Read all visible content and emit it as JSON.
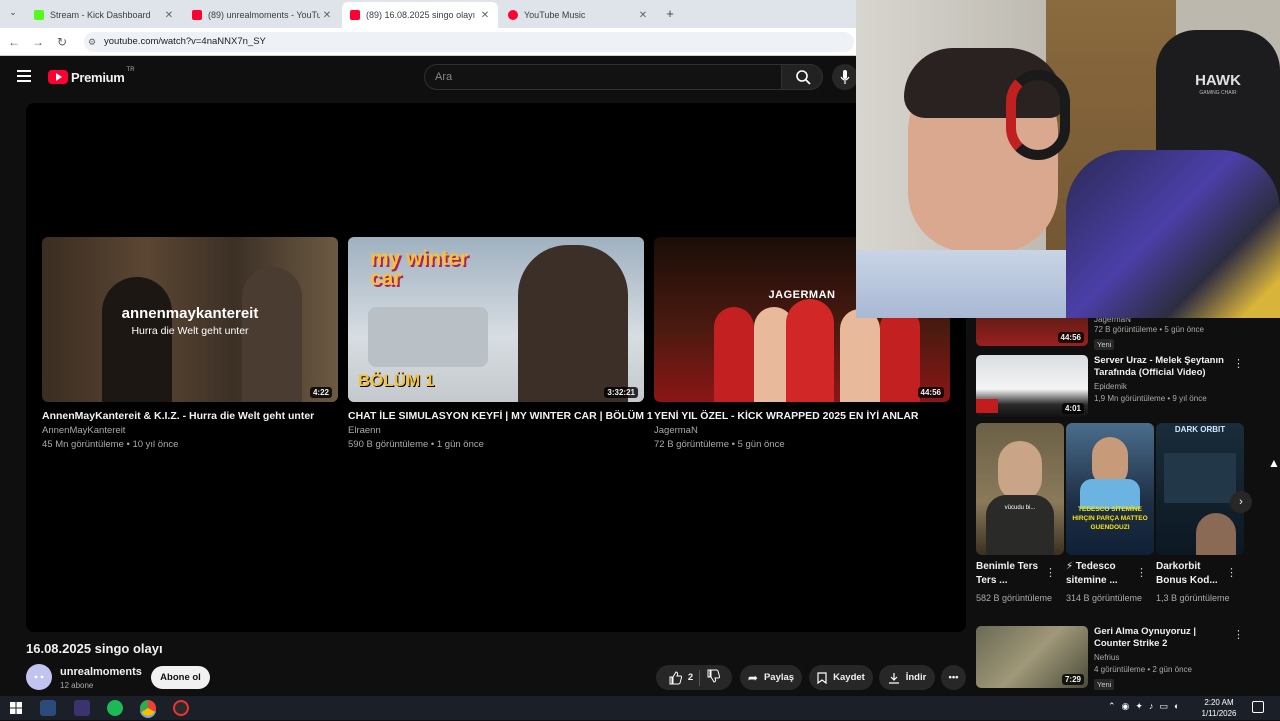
{
  "browser": {
    "tabs": [
      {
        "label": "Stream - Kick Dashboard",
        "fav_color": "#53fc18",
        "active": false
      },
      {
        "label": "(89) unrealmoments - YouTube",
        "fav_color": "#ff0033",
        "active": false
      },
      {
        "label": "(89) 16.08.2025 singo olayı - Yo",
        "fav_color": "#ff0033",
        "active": true
      },
      {
        "label": "YouTube Music",
        "fav_color": "#ff0033",
        "active": false
      }
    ],
    "url": "youtube.com/watch?v=4naNNX7n_SY"
  },
  "masthead": {
    "logo_text": "Premium",
    "country_code": "TR",
    "search_placeholder": "Ara"
  },
  "endscreen": [
    {
      "title": "AnnenMayKantereit & K.I.Z. - Hurra die Welt geht unter",
      "channel": "AnnenMayKantereit",
      "meta": "45 Mn görüntüleme • 10 yıl önce",
      "duration": "4:22",
      "overlay_title": "annenmaykantereit",
      "overlay_sub": "Hurra die Welt geht unter"
    },
    {
      "title": "CHAT İLE SIMULASYON KEYFİ | MY WINTER CAR | BÖLÜM 1",
      "channel": "Elraenn",
      "meta": "590 B görüntüleme • 1 gün önce",
      "duration": "3:32:21",
      "overlay_title": "my winter car",
      "overlay_sub": "BÖLÜM 1"
    },
    {
      "title": "YENİ YIL ÖZEL - KİCK WRAPPED 2025 EN İYİ ANLAR",
      "channel": "JagermaN",
      "meta": "72 B görüntüleme • 5 gün önce",
      "duration": "44:56",
      "overlay_title": "JAGERMAN",
      "overlay_sub": ""
    }
  ],
  "video": {
    "title": "16.08.2025 singo olayı",
    "channel": "unrealmoments",
    "subscribers": "12 abone",
    "subscribe_label": "Abone ol",
    "likes": "2",
    "share_label": "Paylaş",
    "save_label": "Kaydet",
    "download_label": "İndir"
  },
  "sidebar": {
    "top_partial": {
      "channel": "JagermaN",
      "meta": "72 B görüntüleme • 5 gün önce",
      "badge": "Yeni",
      "duration": "44:56"
    },
    "items": [
      {
        "title": "Server Uraz - Melek Şeytanın Tarafında (Official Video)",
        "channel": "Epidemik",
        "meta": "1,9 Mn görüntüleme • 9 yıl önce",
        "duration": "4:01"
      },
      {
        "title": "Geri Alma Oynuyoruz | Counter Strike 2",
        "channel": "Nefrius",
        "meta": "4 görüntüleme • 2 gün önce",
        "badge": "Yeni",
        "duration": "7:29"
      }
    ],
    "shorts": [
      {
        "title": "Benimle Ters Ters ...",
        "views": "582 B görüntüleme",
        "caption": "vücudu bi..."
      },
      {
        "title": "⚡ Tedesco sitemine ...",
        "views": "314 B görüntüleme",
        "caption": "TEDESCO SİTEMİNE HIRÇIN PARÇA MATTEO GUENDOUZI"
      },
      {
        "title": "Darkorbit Bonus Kod...",
        "views": "1,3 B görüntüleme",
        "caption": "DARK ORBIT"
      }
    ]
  },
  "webcam": {
    "chair_brand": "HAWK",
    "chair_sub": "GAMING CHAIR"
  },
  "taskbar": {
    "time": "2:20 AM",
    "date": "1/11/2026"
  }
}
